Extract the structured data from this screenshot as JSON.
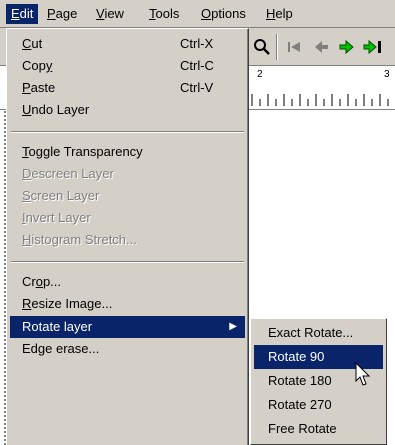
{
  "menubar": {
    "items": [
      {
        "label": "Edit",
        "key": "E"
      },
      {
        "label": "Page",
        "key": "P"
      },
      {
        "label": "View",
        "key": "V"
      },
      {
        "label": "Tools",
        "key": "T"
      },
      {
        "label": "Options",
        "key": "O"
      },
      {
        "label": "Help",
        "key": "H"
      }
    ],
    "active": "Edit"
  },
  "ruler": {
    "numbers": [
      "2",
      "3"
    ]
  },
  "edit_menu": {
    "group1": [
      {
        "pre": "",
        "key": "C",
        "post": "ut",
        "shortcut": "Ctrl-X"
      },
      {
        "pre": "Cop",
        "key": "y",
        "post": "",
        "shortcut": "Ctrl-C"
      },
      {
        "pre": "",
        "key": "P",
        "post": "aste",
        "shortcut": "Ctrl-V"
      },
      {
        "pre": "",
        "key": "U",
        "post": "ndo Layer",
        "shortcut": ""
      }
    ],
    "group2": [
      {
        "pre": "",
        "key": "T",
        "post": "oggle Transparency",
        "enabled": true
      },
      {
        "pre": "",
        "key": "D",
        "post": "escreen Layer",
        "enabled": false
      },
      {
        "pre": "",
        "key": "S",
        "post": "creen Layer",
        "enabled": false
      },
      {
        "pre": "",
        "key": "I",
        "post": "nvert Layer",
        "enabled": false
      },
      {
        "pre": "",
        "key": "H",
        "post": "istogram Stretch...",
        "enabled": false
      }
    ],
    "group3": [
      {
        "pre": "Cr",
        "key": "o",
        "post": "p...",
        "highlight": false
      },
      {
        "pre": "",
        "key": "R",
        "post": "esize Image...",
        "highlight": false
      },
      {
        "pre": "Rotate layer",
        "key": "",
        "post": "",
        "highlight": true,
        "submenu": true
      },
      {
        "pre": "Edge erase...",
        "key": "",
        "post": "",
        "highlight": false
      }
    ]
  },
  "rotate_submenu": {
    "items": [
      "Exact Rotate...",
      "Rotate 90",
      "Rotate 180",
      "Rotate 270",
      "Free Rotate"
    ],
    "selected": "Rotate 90"
  },
  "colors": {
    "menu_bg": "#d4d0c8",
    "highlight": "#0a246a",
    "disabled": "#808080",
    "green_arrow": "#00c000"
  }
}
